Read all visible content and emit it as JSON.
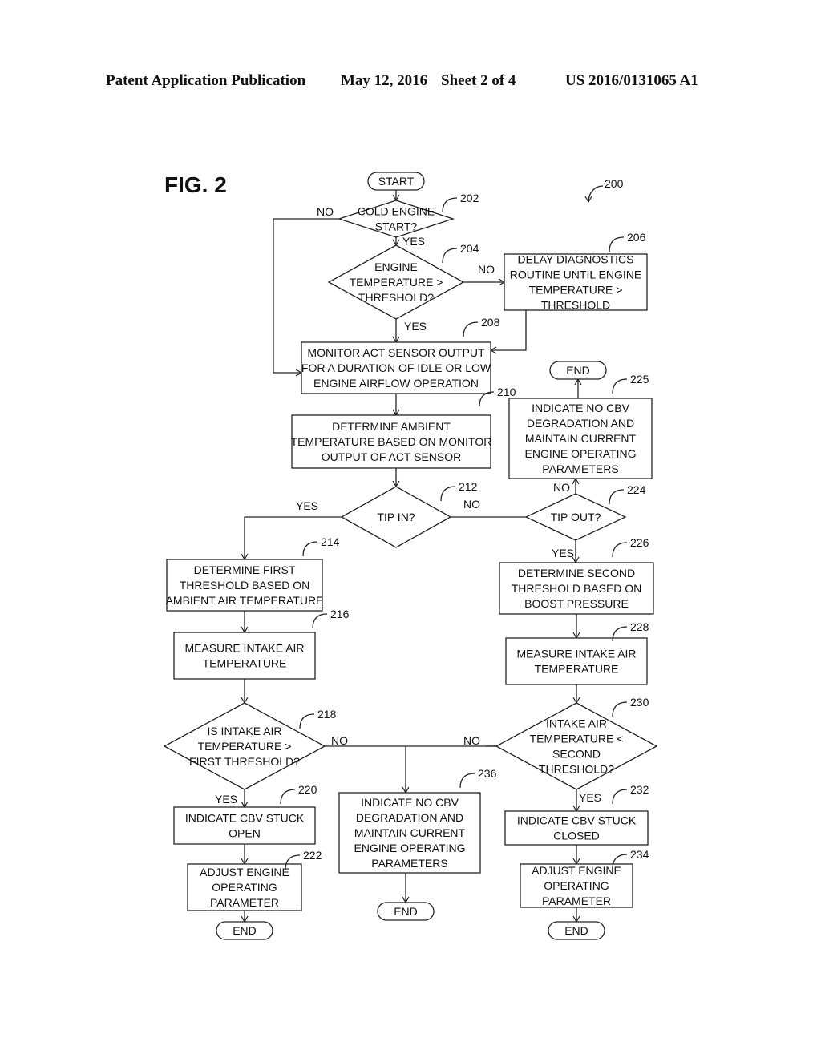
{
  "header": {
    "publication": "Patent Application Publication",
    "date": "May 12, 2016",
    "sheet": "Sheet 2 of 4",
    "number": "US 2016/0131065 A1"
  },
  "figure": {
    "title": "FIG. 2",
    "ref": "200"
  },
  "nodes": {
    "start": {
      "lines": [
        "START"
      ]
    },
    "n202": {
      "ref": "202",
      "lines": [
        "COLD ENGINE",
        "START?"
      ]
    },
    "n204": {
      "ref": "204",
      "lines": [
        "ENGINE",
        "TEMPERATURE >",
        "THRESHOLD?"
      ]
    },
    "n206": {
      "ref": "206",
      "lines": [
        "DELAY DIAGNOSTICS",
        "ROUTINE UNTIL ENGINE",
        "TEMPERATURE >",
        "THRESHOLD"
      ]
    },
    "n208": {
      "ref": "208",
      "lines": [
        "MONITOR ACT SENSOR OUTPUT",
        "FOR A DURATION OF IDLE OR LOW",
        "ENGINE AIRFLOW OPERATION"
      ]
    },
    "n210": {
      "ref": "210",
      "lines": [
        "DETERMINE AMBIENT",
        "TEMPERATURE BASED ON MONITOR",
        "OUTPUT OF ACT SENSOR"
      ]
    },
    "n212": {
      "ref": "212",
      "lines": [
        "TIP IN?"
      ]
    },
    "n214": {
      "ref": "214",
      "lines": [
        "DETERMINE FIRST",
        "THRESHOLD BASED ON",
        "AMBIENT AIR TEMPERATURE"
      ]
    },
    "n216": {
      "ref": "216",
      "lines": [
        "MEASURE INTAKE AIR",
        "TEMPERATURE"
      ]
    },
    "n218": {
      "ref": "218",
      "lines": [
        "IS INTAKE AIR",
        "TEMPERATURE >",
        "FIRST THRESHOLD?"
      ]
    },
    "n220": {
      "ref": "220",
      "lines": [
        "INDICATE CBV STUCK",
        "OPEN"
      ]
    },
    "n222": {
      "ref": "222",
      "lines": [
        "ADJUST ENGINE",
        "OPERATING",
        "PARAMETER"
      ]
    },
    "n224": {
      "ref": "224",
      "lines": [
        "TIP OUT?"
      ]
    },
    "n225": {
      "ref": "225",
      "lines": [
        "INDICATE NO CBV",
        "DEGRADATION AND",
        "MAINTAIN CURRENT",
        "ENGINE OPERATING",
        "PARAMETERS"
      ]
    },
    "n226": {
      "ref": "226",
      "lines": [
        "DETERMINE SECOND",
        "THRESHOLD BASED ON",
        "BOOST PRESSURE"
      ]
    },
    "n228": {
      "ref": "228",
      "lines": [
        "MEASURE INTAKE AIR",
        "TEMPERATURE"
      ]
    },
    "n230": {
      "ref": "230",
      "lines": [
        "INTAKE AIR",
        "TEMPERATURE <",
        "SECOND",
        "THRESHOLD?"
      ]
    },
    "n232": {
      "ref": "232",
      "lines": [
        "INDICATE CBV STUCK",
        "CLOSED"
      ]
    },
    "n234": {
      "ref": "234",
      "lines": [
        "ADJUST ENGINE",
        "OPERATING",
        "PARAMETER"
      ]
    },
    "n236": {
      "ref": "236",
      "lines": [
        "INDICATE NO CBV",
        "DEGRADATION AND",
        "MAINTAIN CURRENT",
        "ENGINE OPERATING",
        "PARAMETERS"
      ]
    },
    "end225": {
      "lines": [
        "END"
      ]
    },
    "end222": {
      "lines": [
        "END"
      ]
    },
    "end236": {
      "lines": [
        "END"
      ]
    },
    "end234": {
      "lines": [
        "END"
      ]
    }
  },
  "labels": {
    "yes": "YES",
    "no": "NO"
  }
}
